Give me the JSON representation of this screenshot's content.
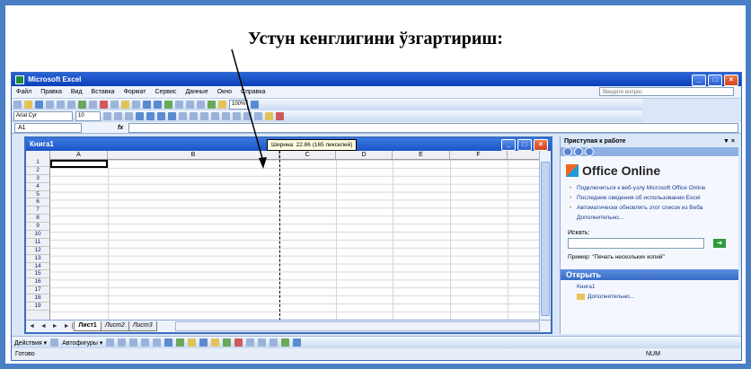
{
  "slide": {
    "title": "Устун кенглигини ўзгартириш:"
  },
  "app": {
    "window_title": "Microsoft Excel",
    "menu": [
      "Файл",
      "Правка",
      "Вид",
      "Вставка",
      "Формат",
      "Сервис",
      "Данные",
      "Окно",
      "Справка"
    ],
    "help_placeholder": "Введите вопрос",
    "toolbar": {
      "zoom": "100%",
      "font_name": "Arial Cyr",
      "font_size": "10"
    },
    "formula": {
      "name_box": "A1",
      "fx": "fx"
    }
  },
  "workbook": {
    "title": "Книга1",
    "tooltip": "Ширина: 22.86 (165 пикселей)",
    "columns": [
      "A",
      "B",
      "C",
      "D",
      "E",
      "F"
    ],
    "rows": [
      "1",
      "2",
      "3",
      "4",
      "5",
      "6",
      "7",
      "8",
      "9",
      "10",
      "11",
      "12",
      "13",
      "14",
      "15",
      "16",
      "17",
      "18",
      "19"
    ],
    "nav_arrows": "◄ ◄ ► ►|",
    "sheets": [
      "Лист1",
      "Лист2",
      "Лист3"
    ],
    "active_sheet": "Лист1",
    "selected_cell": "A1"
  },
  "task_pane": {
    "title": "Приступая к работе",
    "close": "▼ ×",
    "office_online": "Office Online",
    "links": [
      "Подключиться к веб-узлу Microsoft Office Online",
      "Последние сведения об использовании Excel",
      "Автоматически обновлять этот список из Веба"
    ],
    "more": "Дополнительно...",
    "search_label": "Искать:",
    "example": "Пример: \"Печать нескольких копий\"",
    "open_title": "Открыть",
    "open_items": [
      "Книга1",
      "Дополнительно..."
    ]
  },
  "drawing_bar": {
    "actions": "Действия ▾",
    "autoshapes": "Автофигуры ▾"
  },
  "status": {
    "ready": "Готово",
    "num": "NUM"
  }
}
